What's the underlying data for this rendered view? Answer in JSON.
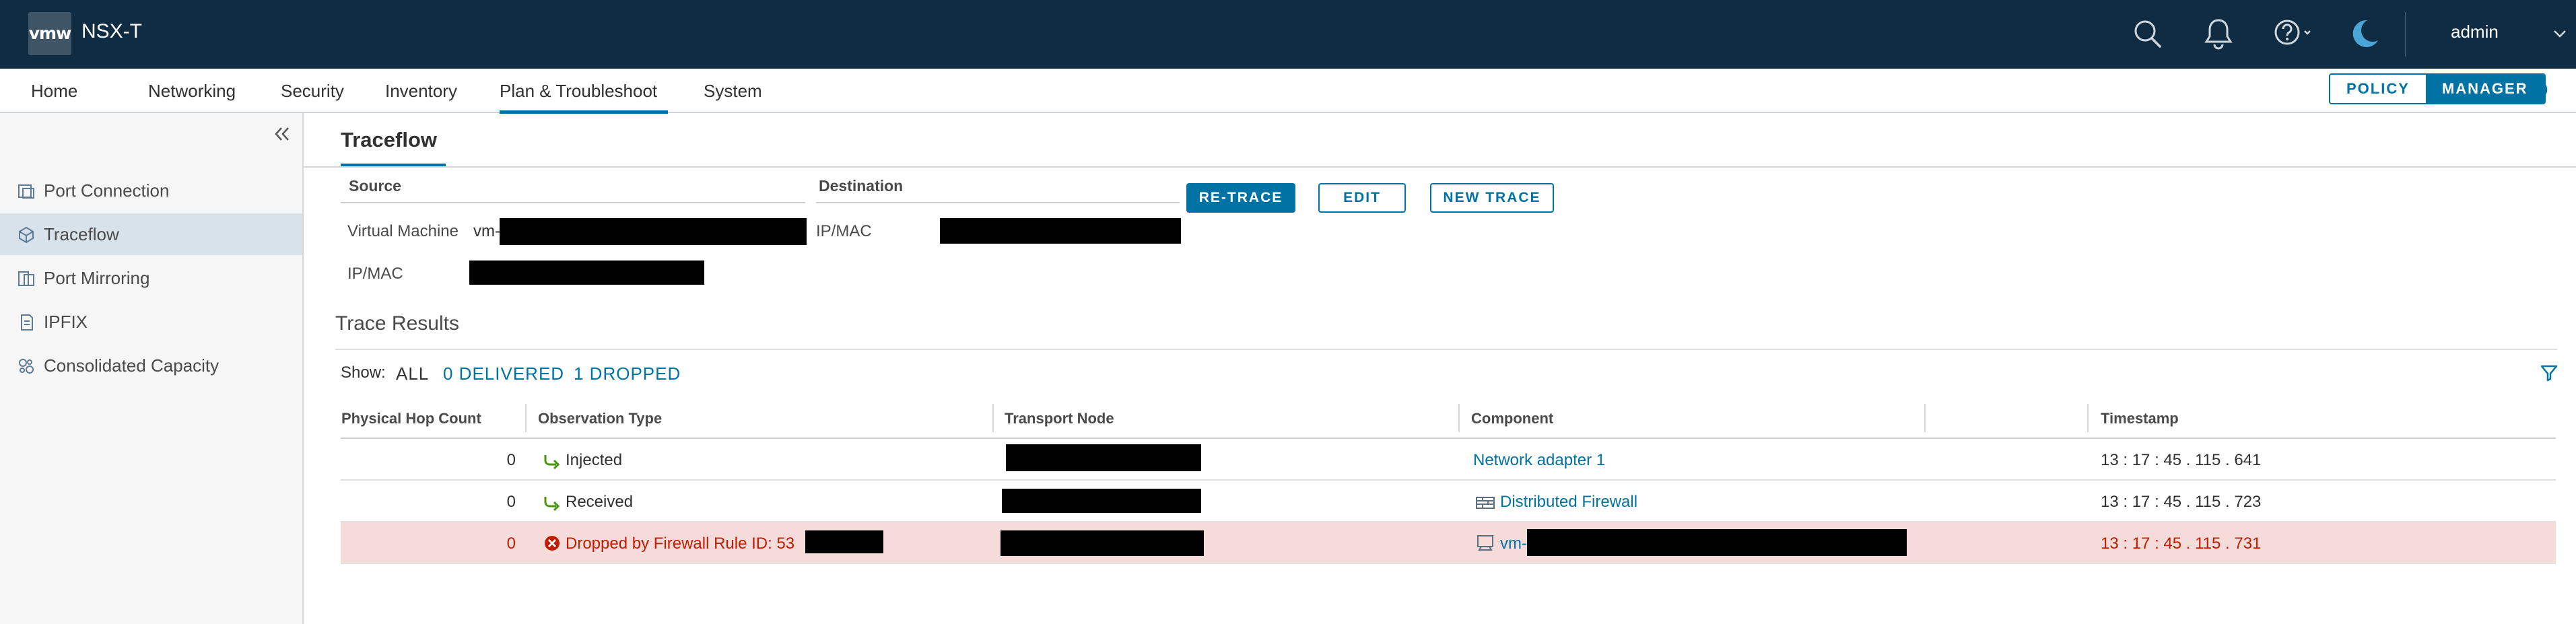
{
  "header": {
    "logo_text": "vmw",
    "app_title": "NSX-T",
    "username": "admin",
    "icons": [
      "search-icon",
      "bell-icon",
      "help-icon",
      "moon-icon",
      "chevron-down-icon"
    ]
  },
  "nav": {
    "items": [
      "Home",
      "Networking",
      "Security",
      "Inventory",
      "Plan & Troubleshoot",
      "System"
    ],
    "active": "Plan & Troubleshoot",
    "mode_policy": "POLICY",
    "mode_manager": "MANAGER"
  },
  "sidebar": {
    "items": [
      {
        "label": "Port Connection",
        "icon": "port-connection-icon"
      },
      {
        "label": "Traceflow",
        "icon": "traceflow-icon"
      },
      {
        "label": "Port Mirroring",
        "icon": "port-mirroring-icon"
      },
      {
        "label": "IPFIX",
        "icon": "ipfix-icon"
      },
      {
        "label": "Consolidated Capacity",
        "icon": "capacity-icon"
      }
    ],
    "active": "Traceflow"
  },
  "page": {
    "title": "Traceflow",
    "source": {
      "heading": "Source",
      "vm_label": "Virtual Machine",
      "vm_value_prefix": "vm-",
      "ipmac_label": "IP/MAC"
    },
    "destination": {
      "heading": "Destination",
      "ipmac_label": "IP/MAC"
    },
    "buttons": {
      "retrace": "RE-TRACE",
      "edit": "EDIT",
      "new_trace": "NEW TRACE"
    }
  },
  "results": {
    "title": "Trace Results",
    "show_label": "Show:",
    "filter_all": "ALL",
    "filter_delivered": "0 DELIVERED",
    "filter_dropped": "1 DROPPED",
    "columns": [
      "Physical Hop Count",
      "Observation Type",
      "Transport Node",
      "Component",
      "Timestamp"
    ],
    "rows": [
      {
        "hop": "0",
        "observation": "Injected",
        "component": "Network adapter 1",
        "timestamp": "13 : 17 : 45 . 115 . 641",
        "status": "ok"
      },
      {
        "hop": "0",
        "observation": "Received",
        "component": "Distributed Firewall",
        "timestamp": "13 : 17 : 45 . 115 . 723",
        "status": "ok"
      },
      {
        "hop": "0",
        "observation": "Dropped by Firewall Rule ID: 53",
        "component": "vm-",
        "timestamp": "13 : 17 : 45 . 115 . 731",
        "status": "dropped"
      }
    ]
  },
  "colors": {
    "header_bg": "#0f2c43",
    "accent": "#0072a3",
    "success_arrow": "#48960c",
    "error": "#c21d00",
    "dropped_row_bg": "#f5dbd9",
    "sidebar_active_bg": "#d7e2ea"
  }
}
